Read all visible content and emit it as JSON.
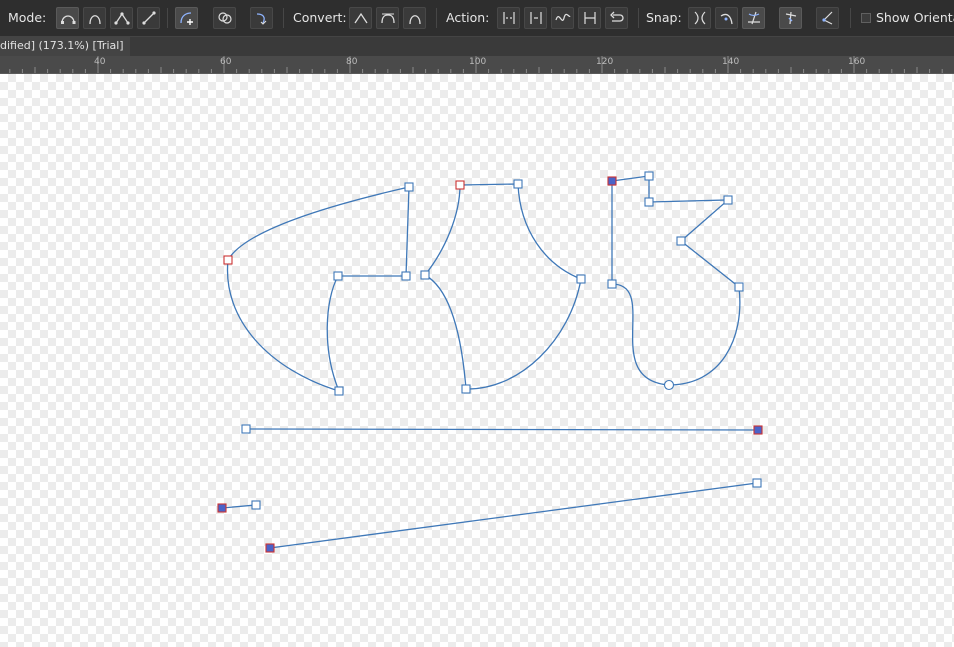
{
  "toolbar": {
    "mode_label": "Mode:",
    "convert_label": "Convert:",
    "action_label": "Action:",
    "snap_label": "Snap:",
    "show_orientation_label": "Show Orientatio"
  },
  "document": {
    "tab_title": "dified] (173.1%) [Trial]"
  },
  "ruler": {
    "labels": [
      "40",
      "60",
      "80",
      "100",
      "120",
      "140",
      "160"
    ]
  },
  "colors": {
    "curve": "#3f78b8",
    "selected_node_outline": "#cc3333",
    "selected_node_fill": "#4a63c8"
  }
}
